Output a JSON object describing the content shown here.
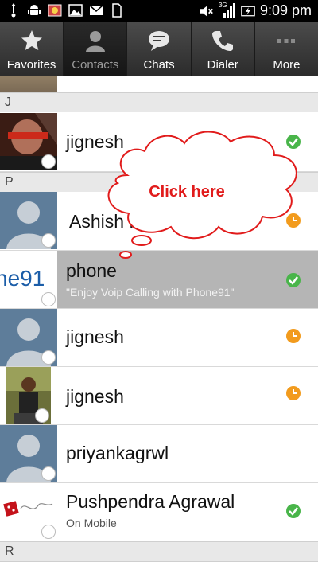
{
  "status_bar": {
    "time": "9:09 pm",
    "network": "3G",
    "icons": [
      "usb-icon",
      "android-icon",
      "gallery-icon",
      "image-icon",
      "mail-icon",
      "sd-card-icon",
      "mute-icon",
      "signal-icon",
      "battery-icon"
    ]
  },
  "tabs": [
    {
      "label": "Favorites",
      "icon": "star-icon",
      "active": false
    },
    {
      "label": "Contacts",
      "icon": "person-icon",
      "active": true
    },
    {
      "label": "Chats",
      "icon": "chat-bubble-icon",
      "active": false
    },
    {
      "label": "Dialer",
      "icon": "phone-handset-icon",
      "active": false
    },
    {
      "label": "More",
      "icon": "more-icon",
      "active": false
    }
  ],
  "contacts": {
    "section_j": "J",
    "section_p": "P",
    "section_r": "R",
    "items": [
      {
        "name": "jignesh",
        "subtitle": "",
        "status": "available"
      },
      {
        "name": "Ashish Rajak",
        "subtitle": "",
        "status": "away"
      },
      {
        "name": "phone",
        "subtitle": "\"Enjoy Voip Calling with Phone91\"",
        "status": "available"
      },
      {
        "name": "jignesh",
        "subtitle": "",
        "status": "away"
      },
      {
        "name": "jignesh",
        "subtitle": "",
        "status": "away"
      },
      {
        "name": "priyankagrwl",
        "subtitle": "",
        "status": "idle"
      },
      {
        "name": "Pushpendra Agrawal",
        "subtitle": "On Mobile",
        "status": "available"
      }
    ]
  },
  "callout": {
    "text": "Click here"
  },
  "colors": {
    "available": "#49b54a",
    "away": "#f29b1d",
    "callout": "#e11b1b",
    "highlight": "#b5b5b5"
  }
}
